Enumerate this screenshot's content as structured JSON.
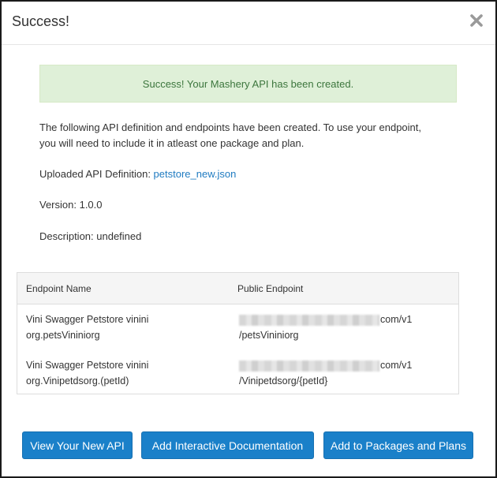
{
  "dialog": {
    "title": "Success!",
    "close_icon": "close-icon"
  },
  "alert": {
    "message": "Success! Your Mashery API has been created.",
    "color": "#3c763d",
    "background": "#dff0d8"
  },
  "intro": {
    "line1": "The following API definition and endpoints have been created. To use your endpoint,",
    "line2": "you will need to include it in atleast one package and plan."
  },
  "details": {
    "uploaded_label": "Uploaded API Definition: ",
    "uploaded_file": "petstore_new.json",
    "version": "Version: 1.0.0",
    "description": "Description: undefined"
  },
  "table": {
    "headers": {
      "name": "Endpoint Name",
      "public": "Public Endpoint"
    },
    "rows": [
      {
        "name_line1": "Vini Swagger Petstore vinini",
        "name_line2": "org.petsVininiorg",
        "endpoint_suffix": "com/v1",
        "endpoint_line2": "/petsVininiorg"
      },
      {
        "name_line1": "Vini Swagger Petstore vinini",
        "name_line2": "org.Vinipetdsorg.(petId)",
        "endpoint_suffix": "com/v1",
        "endpoint_line2": "/Vinipetdsorg/{petId}"
      }
    ]
  },
  "buttons": {
    "view": "View Your New API",
    "docs": "Add Interactive Documentation",
    "packages": "Add to Packages and Plans",
    "color": "#1a80c9"
  }
}
